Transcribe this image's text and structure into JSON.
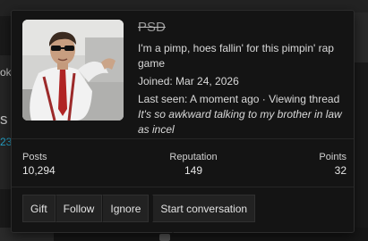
{
  "background": {
    "left_fragment_top": "oks",
    "left_fragment_mid": "s",
    "left_fragment_num": "23"
  },
  "profile": {
    "username": "PSD",
    "title": "I'm a pimp, hoes fallin' for this pimpin' rap game",
    "joined": "Joined: Mar 24, 2026",
    "last_seen_prefix": "Last seen: A moment ago · Viewing thread",
    "last_seen_thread": "It's so awkward talking to my brother in law as incel"
  },
  "stats": {
    "posts_label": "Posts",
    "posts_value": "10,294",
    "reputation_label": "Reputation",
    "reputation_value": "149",
    "points_label": "Points",
    "points_value": "32"
  },
  "actions": {
    "gift": "Gift",
    "follow": "Follow",
    "ignore": "Ignore",
    "start_conversation": "Start conversation"
  },
  "colors": {
    "card_bg": "#141414",
    "button_bg": "#222222",
    "accent_cyan": "#26a3c9",
    "text": "#d9d9d9"
  }
}
